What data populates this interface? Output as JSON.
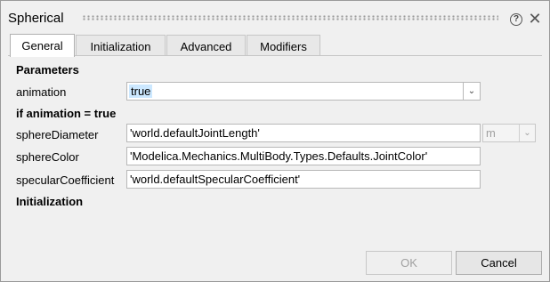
{
  "window": {
    "title": "Spherical",
    "help_glyph": "?",
    "close_glyph": "✕"
  },
  "tabs": [
    {
      "label": "General",
      "active": true
    },
    {
      "label": "Initialization",
      "active": false
    },
    {
      "label": "Advanced",
      "active": false
    },
    {
      "label": "Modifiers",
      "active": false
    }
  ],
  "sections": {
    "parameters": "Parameters",
    "if_animation": "if animation = true",
    "initialization": "Initialization"
  },
  "params": {
    "animation": {
      "label": "animation",
      "value": "true"
    },
    "sphereDiameter": {
      "label": "sphereDiameter",
      "value": "'world.defaultJointLength'",
      "unit": "m"
    },
    "sphereColor": {
      "label": "sphereColor",
      "value": "'Modelica.Mechanics.MultiBody.Types.Defaults.JointColor'"
    },
    "specularCoefficient": {
      "label": "specularCoefficient",
      "value": "'world.defaultSpecularCoefficient'"
    }
  },
  "buttons": {
    "ok": {
      "label": "OK",
      "enabled": false
    },
    "cancel": {
      "label": "Cancel",
      "enabled": true
    }
  },
  "colors": {
    "selection": "#cce8ff",
    "dialog_bg": "#f0f0f0"
  }
}
